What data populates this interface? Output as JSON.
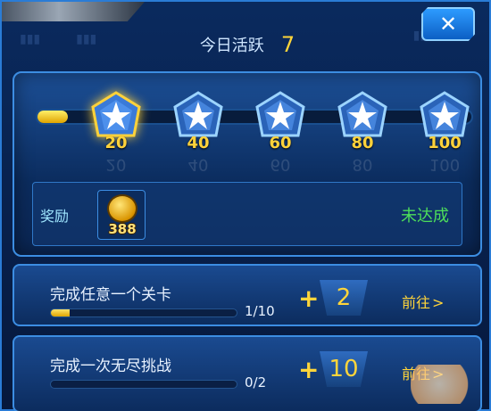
{
  "header": {
    "label": "今日活跃",
    "value": "7"
  },
  "close_icon": "close-icon",
  "activity": {
    "current": 7,
    "max": 100,
    "milestones": [
      {
        "label": "20",
        "active": true
      },
      {
        "label": "40",
        "active": false
      },
      {
        "label": "60",
        "active": false
      },
      {
        "label": "80",
        "active": false
      },
      {
        "label": "100",
        "active": false
      }
    ]
  },
  "reward": {
    "label": "奖励",
    "item_icon": "gold-coin-icon",
    "item_count": "388",
    "status": "未达成"
  },
  "tasks": [
    {
      "title": "完成任意一个关卡",
      "progress": "1/10",
      "progress_fraction": 0.1,
      "plus": "+",
      "reward": "2",
      "goto": "前往",
      "goto_icon": "chevron-right-icon"
    },
    {
      "title": "完成一次无尽挑战",
      "progress": "0/2",
      "progress_fraction": 0,
      "plus": "+",
      "reward": "10",
      "goto": "前往",
      "goto_icon": "chevron-right-icon"
    }
  ],
  "colors": {
    "accent_gold": "#ffd53a",
    "status_green": "#4dde5a",
    "panel_blue": "#1c4f96",
    "border_blue": "#3c8de2"
  }
}
